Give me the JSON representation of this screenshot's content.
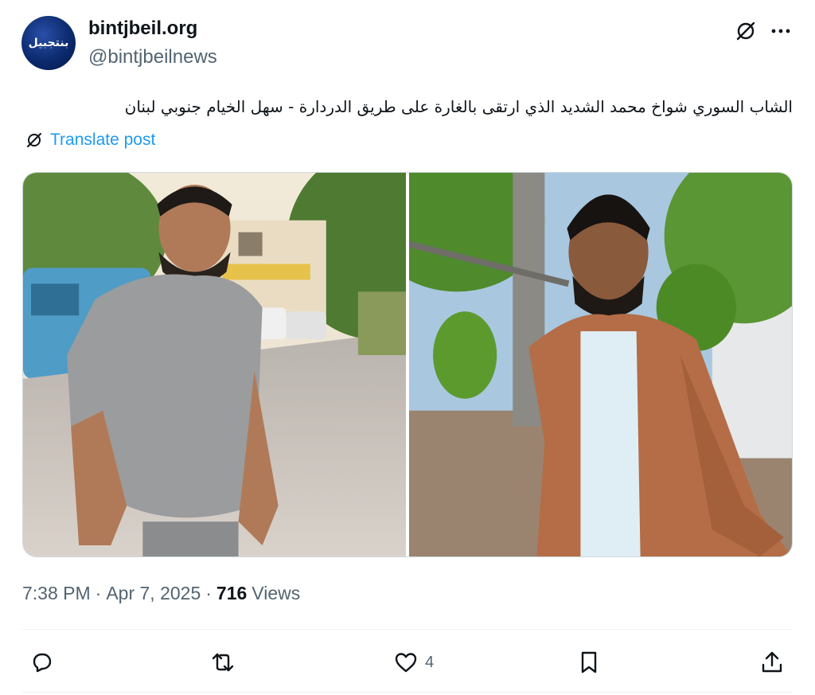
{
  "author": {
    "avatar_text": "بنتجبيل",
    "display_name": "bintjbeil.org",
    "handle": "@bintjbeilnews"
  },
  "header_icons": {
    "grok": "grok-icon",
    "more": "more-icon"
  },
  "tweet": {
    "text": "الشاب السوري شواخ محمد الشديد الذي ارتقى بالغارة على طريق الدردارة - سهل الخيام جنوبي لبنان",
    "translate_label": "Translate post"
  },
  "meta": {
    "time": "7:38 PM",
    "date": "Apr 7, 2025",
    "views_count": "716",
    "views_label": "Views"
  },
  "actions": {
    "reply": {
      "icon": "reply-icon"
    },
    "repost": {
      "icon": "repost-icon"
    },
    "like": {
      "icon": "heart-icon",
      "count": "4"
    },
    "bookmark": {
      "icon": "bookmark-icon"
    },
    "share": {
      "icon": "share-icon"
    }
  },
  "colors": {
    "accent": "#1d9bf0",
    "text_primary": "#0f1419",
    "text_secondary": "#536471",
    "border": "#cfd9de"
  }
}
